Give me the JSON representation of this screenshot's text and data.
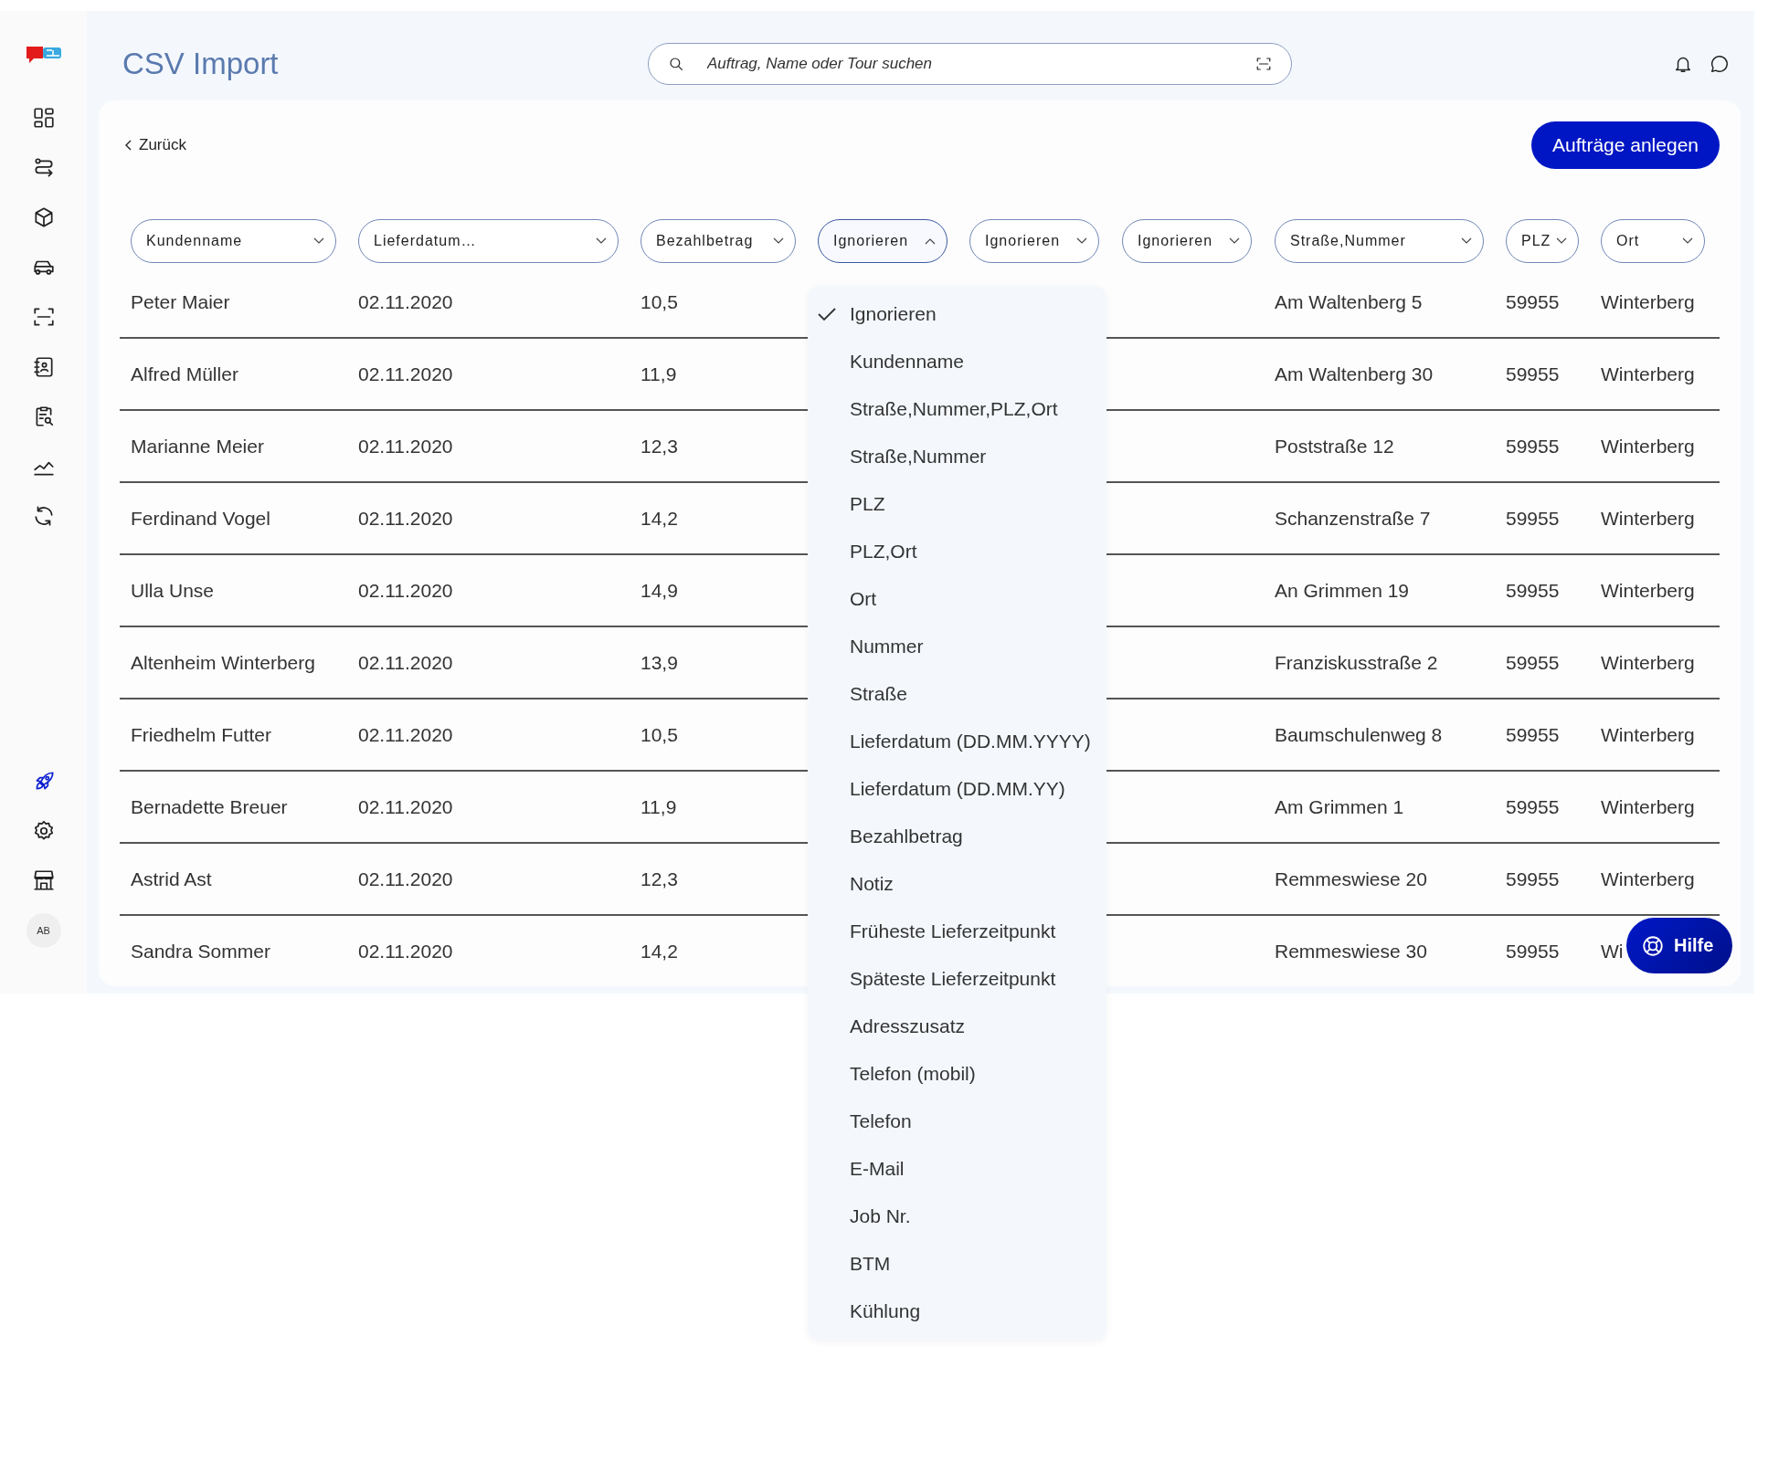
{
  "sidebar": {
    "items": [
      {
        "selected": false
      },
      {
        "selected": false
      },
      {
        "selected": false
      },
      {
        "selected": false
      },
      {
        "selected": false
      },
      {
        "selected": false
      },
      {
        "selected": false
      },
      {
        "selected": false
      },
      {
        "selected": false
      }
    ],
    "bottom_items": [
      {
        "selected": true
      },
      {
        "selected": false
      },
      {
        "selected": false
      }
    ],
    "avatar": "AB"
  },
  "header": {
    "title": "CSV Import",
    "search": {
      "placeholder": "Auftrag, Name oder Tour suchen"
    }
  },
  "back_link": "Zurück",
  "primary_button": "Aufträge anlegen",
  "table": {
    "columns": [
      {
        "label": "Kundenname",
        "kind": "mapped",
        "expanded": false
      },
      {
        "label": "Lieferdatum…",
        "kind": "mapped",
        "expanded": false
      },
      {
        "label": "Bezahlbetrag",
        "kind": "mapped",
        "expanded": false
      },
      {
        "label": "Ignorieren",
        "kind": "ignored",
        "expanded": true
      },
      {
        "label": "Ignorieren",
        "kind": "ignored",
        "expanded": false
      },
      {
        "label": "Ignorieren",
        "kind": "ignored",
        "expanded": false
      },
      {
        "label": "Straße,Nummer",
        "kind": "mapped",
        "expanded": false
      },
      {
        "label": "PLZ",
        "kind": "mapped",
        "expanded": false
      },
      {
        "label": "Ort",
        "kind": "mapped",
        "expanded": false
      }
    ],
    "rows": [
      [
        "Peter Maier",
        "02.11.2020",
        "10,5",
        "Am Waltenberg 5",
        "59955",
        "Winterberg"
      ],
      [
        "Alfred Müller",
        "02.11.2020",
        "11,9",
        "Am Waltenberg 30",
        "59955",
        "Winterberg"
      ],
      [
        "Marianne Meier",
        "02.11.2020",
        "12,3",
        "Poststraße 12",
        "59955",
        "Winterberg"
      ],
      [
        "Ferdinand Vogel",
        "02.11.2020",
        "14,2",
        "Schanzenstraße 7",
        "59955",
        "Winterberg"
      ],
      [
        "Ulla Unse",
        "02.11.2020",
        "14,9",
        "An Grimmen 19",
        "59955",
        "Winterberg"
      ],
      [
        "Altenheim Winterberg",
        "02.11.2020",
        "13,9",
        "Franziskusstraße 2",
        "59955",
        "Winterberg"
      ],
      [
        "Friedhelm Futter",
        "02.11.2020",
        "10,5",
        "Baumschulenweg 8",
        "59955",
        "Winterberg"
      ],
      [
        "Bernadette Breuer",
        "02.11.2020",
        "11,9",
        "Am Grimmen 1",
        "59955",
        "Winterberg"
      ],
      [
        "Astrid Ast",
        "02.11.2020",
        "12,3",
        "Remmeswiese 20",
        "59955",
        "Winterberg"
      ],
      [
        "Sandra Sommer",
        "02.11.2020",
        "14,2",
        "Remmeswiese 30",
        "59955",
        "Wi"
      ]
    ]
  },
  "dropdown": {
    "options": [
      {
        "label": "Ignorieren",
        "selected": true
      },
      {
        "label": "Kundenname",
        "selected": false
      },
      {
        "label": "Straße,Nummer,PLZ,Ort",
        "selected": false
      },
      {
        "label": "Straße,Nummer",
        "selected": false
      },
      {
        "label": "PLZ",
        "selected": false
      },
      {
        "label": "PLZ,Ort",
        "selected": false
      },
      {
        "label": "Ort",
        "selected": false
      },
      {
        "label": "Nummer",
        "selected": false
      },
      {
        "label": "Straße",
        "selected": false
      },
      {
        "label": "Lieferdatum (DD.MM.YYYY)",
        "selected": false
      },
      {
        "label": "Lieferdatum (DD.MM.YY)",
        "selected": false
      },
      {
        "label": "Bezahlbetrag",
        "selected": false
      },
      {
        "label": "Notiz",
        "selected": false
      },
      {
        "label": "Früheste Lieferzeitpunkt",
        "selected": false
      },
      {
        "label": "Späteste Lieferzeitpunkt",
        "selected": false
      },
      {
        "label": "Adresszusatz",
        "selected": false
      },
      {
        "label": "Telefon (mobil)",
        "selected": false
      },
      {
        "label": "Telefon",
        "selected": false
      },
      {
        "label": "E-Mail",
        "selected": false
      },
      {
        "label": "Job Nr.",
        "selected": false
      },
      {
        "label": "BTM",
        "selected": false
      },
      {
        "label": "Kühlung",
        "selected": false
      }
    ]
  },
  "help_button": "Hilfe"
}
